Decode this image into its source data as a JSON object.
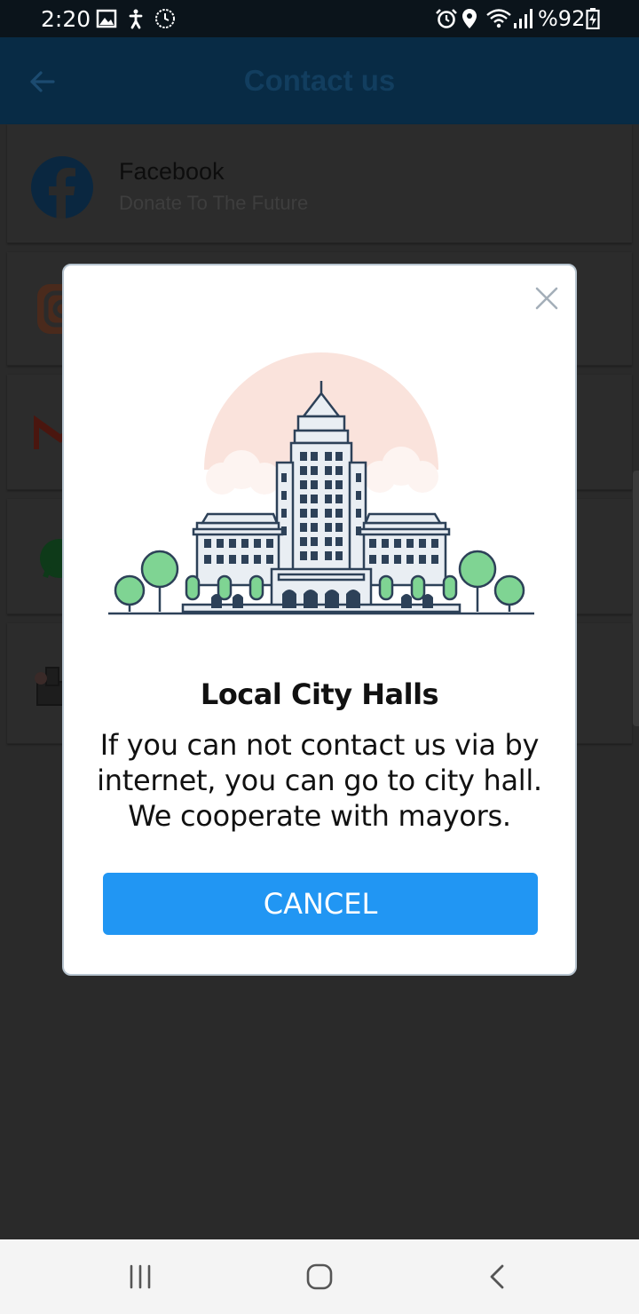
{
  "status_bar": {
    "time": "2:20",
    "battery": "%92",
    "left_icons": [
      "image-icon",
      "accessibility-icon",
      "clock-icon"
    ],
    "right_icons": [
      "alarm-icon",
      "location-icon",
      "wifi-icon",
      "signal-icon",
      "battery-charging-icon"
    ]
  },
  "app_bar": {
    "title": "Contact us",
    "back_icon": "arrow-back-icon"
  },
  "contact_list": [
    {
      "title": "Facebook",
      "subtitle": "Donate To The Future",
      "icon": "facebook-icon"
    },
    {
      "title": "",
      "subtitle": "",
      "icon": "instagram-icon"
    },
    {
      "title": "",
      "subtitle": "",
      "icon": "gmail-icon"
    },
    {
      "title": "",
      "subtitle": "",
      "icon": "whatsapp-icon"
    },
    {
      "title": "",
      "subtitle": "",
      "icon": "city-hall-icon"
    }
  ],
  "dialog": {
    "title": "Local City Halls",
    "body": "If you can not contact us via by internet, you can go to city hall. We cooperate with mayors.",
    "cancel_label": "CANCEL",
    "close_icon": "close-icon",
    "illustration": "city-hall-illustration"
  },
  "navigation_bar": {
    "buttons": [
      "recents-icon",
      "home-icon",
      "back-icon"
    ]
  },
  "colors": {
    "primary": "#2196f3",
    "app_bar": "#0d4f80",
    "scrim": "rgba(0,0,0,0.82)"
  }
}
